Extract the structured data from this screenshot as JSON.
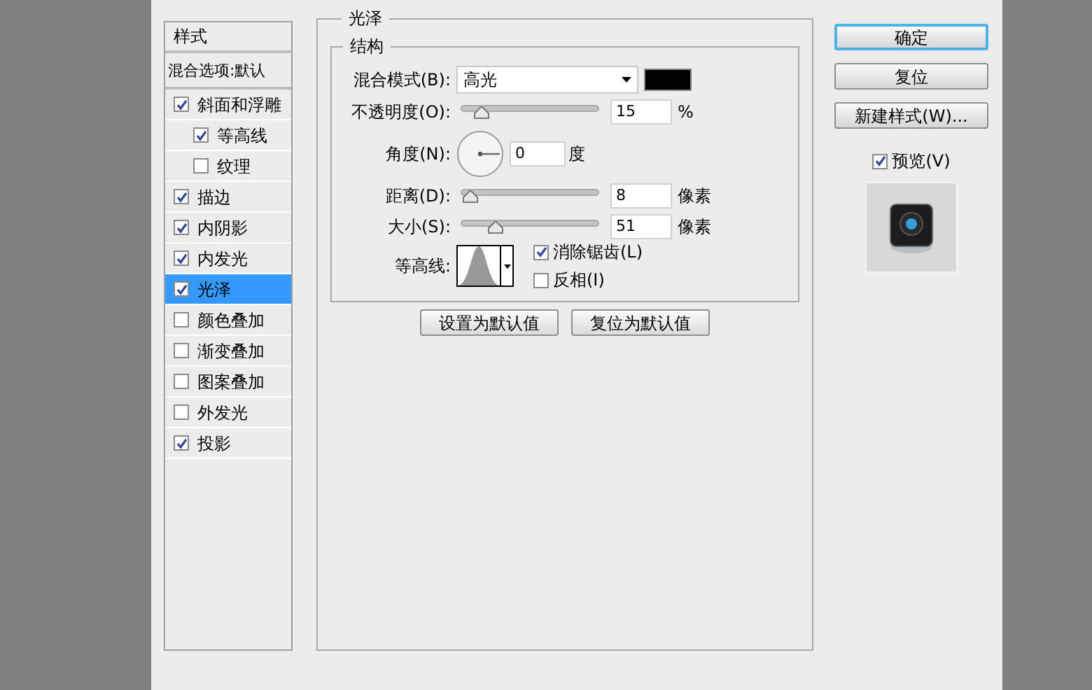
{
  "sidebar": {
    "title": "样式",
    "blending_options": "混合选项:默认",
    "items": [
      {
        "label": "斜面和浮雕",
        "checked": true,
        "selected": false,
        "children": [
          {
            "label": "等高线",
            "checked": true,
            "selected": false
          },
          {
            "label": "纹理",
            "checked": false,
            "selected": false
          }
        ]
      },
      {
        "label": "描边",
        "checked": true,
        "selected": false
      },
      {
        "label": "内阴影",
        "checked": true,
        "selected": false
      },
      {
        "label": "内发光",
        "checked": true,
        "selected": false
      },
      {
        "label": "光泽",
        "checked": true,
        "selected": true
      },
      {
        "label": "颜色叠加",
        "checked": false,
        "selected": false
      },
      {
        "label": "渐变叠加",
        "checked": false,
        "selected": false
      },
      {
        "label": "图案叠加",
        "checked": false,
        "selected": false
      },
      {
        "label": "外发光",
        "checked": false,
        "selected": false
      },
      {
        "label": "投影",
        "checked": true,
        "selected": false
      }
    ]
  },
  "panel": {
    "title": "光泽",
    "group": {
      "title": "结构",
      "blend_mode": {
        "label": "混合模式(B):",
        "value": "高光"
      },
      "opacity": {
        "label": "不透明度(O):",
        "level": 0.15,
        "value": "15",
        "unit": "%"
      },
      "angle": {
        "label": "角度(N):",
        "value": "0",
        "unit": "度"
      },
      "distance": {
        "label": "距离(D):",
        "level": 0.07,
        "value": "8",
        "unit": "像素"
      },
      "size": {
        "label": "大小(S):",
        "level": 0.25,
        "value": "51",
        "unit": "像素"
      },
      "contour": {
        "label": "等高线:",
        "options": [
          {
            "label": "消除锯齿(L)",
            "checked": true
          },
          {
            "label": "反相(I)",
            "checked": false
          }
        ]
      }
    },
    "buttons": [
      "设置为默认值",
      "复位为默认值"
    ]
  },
  "actions": {
    "buttons": [
      {
        "label": "确定",
        "default": true
      },
      {
        "label": "复位",
        "default": false
      },
      {
        "label": "新建样式(W)...",
        "default": false
      }
    ],
    "preview": {
      "label": "预览(V)",
      "checked": true
    }
  }
}
